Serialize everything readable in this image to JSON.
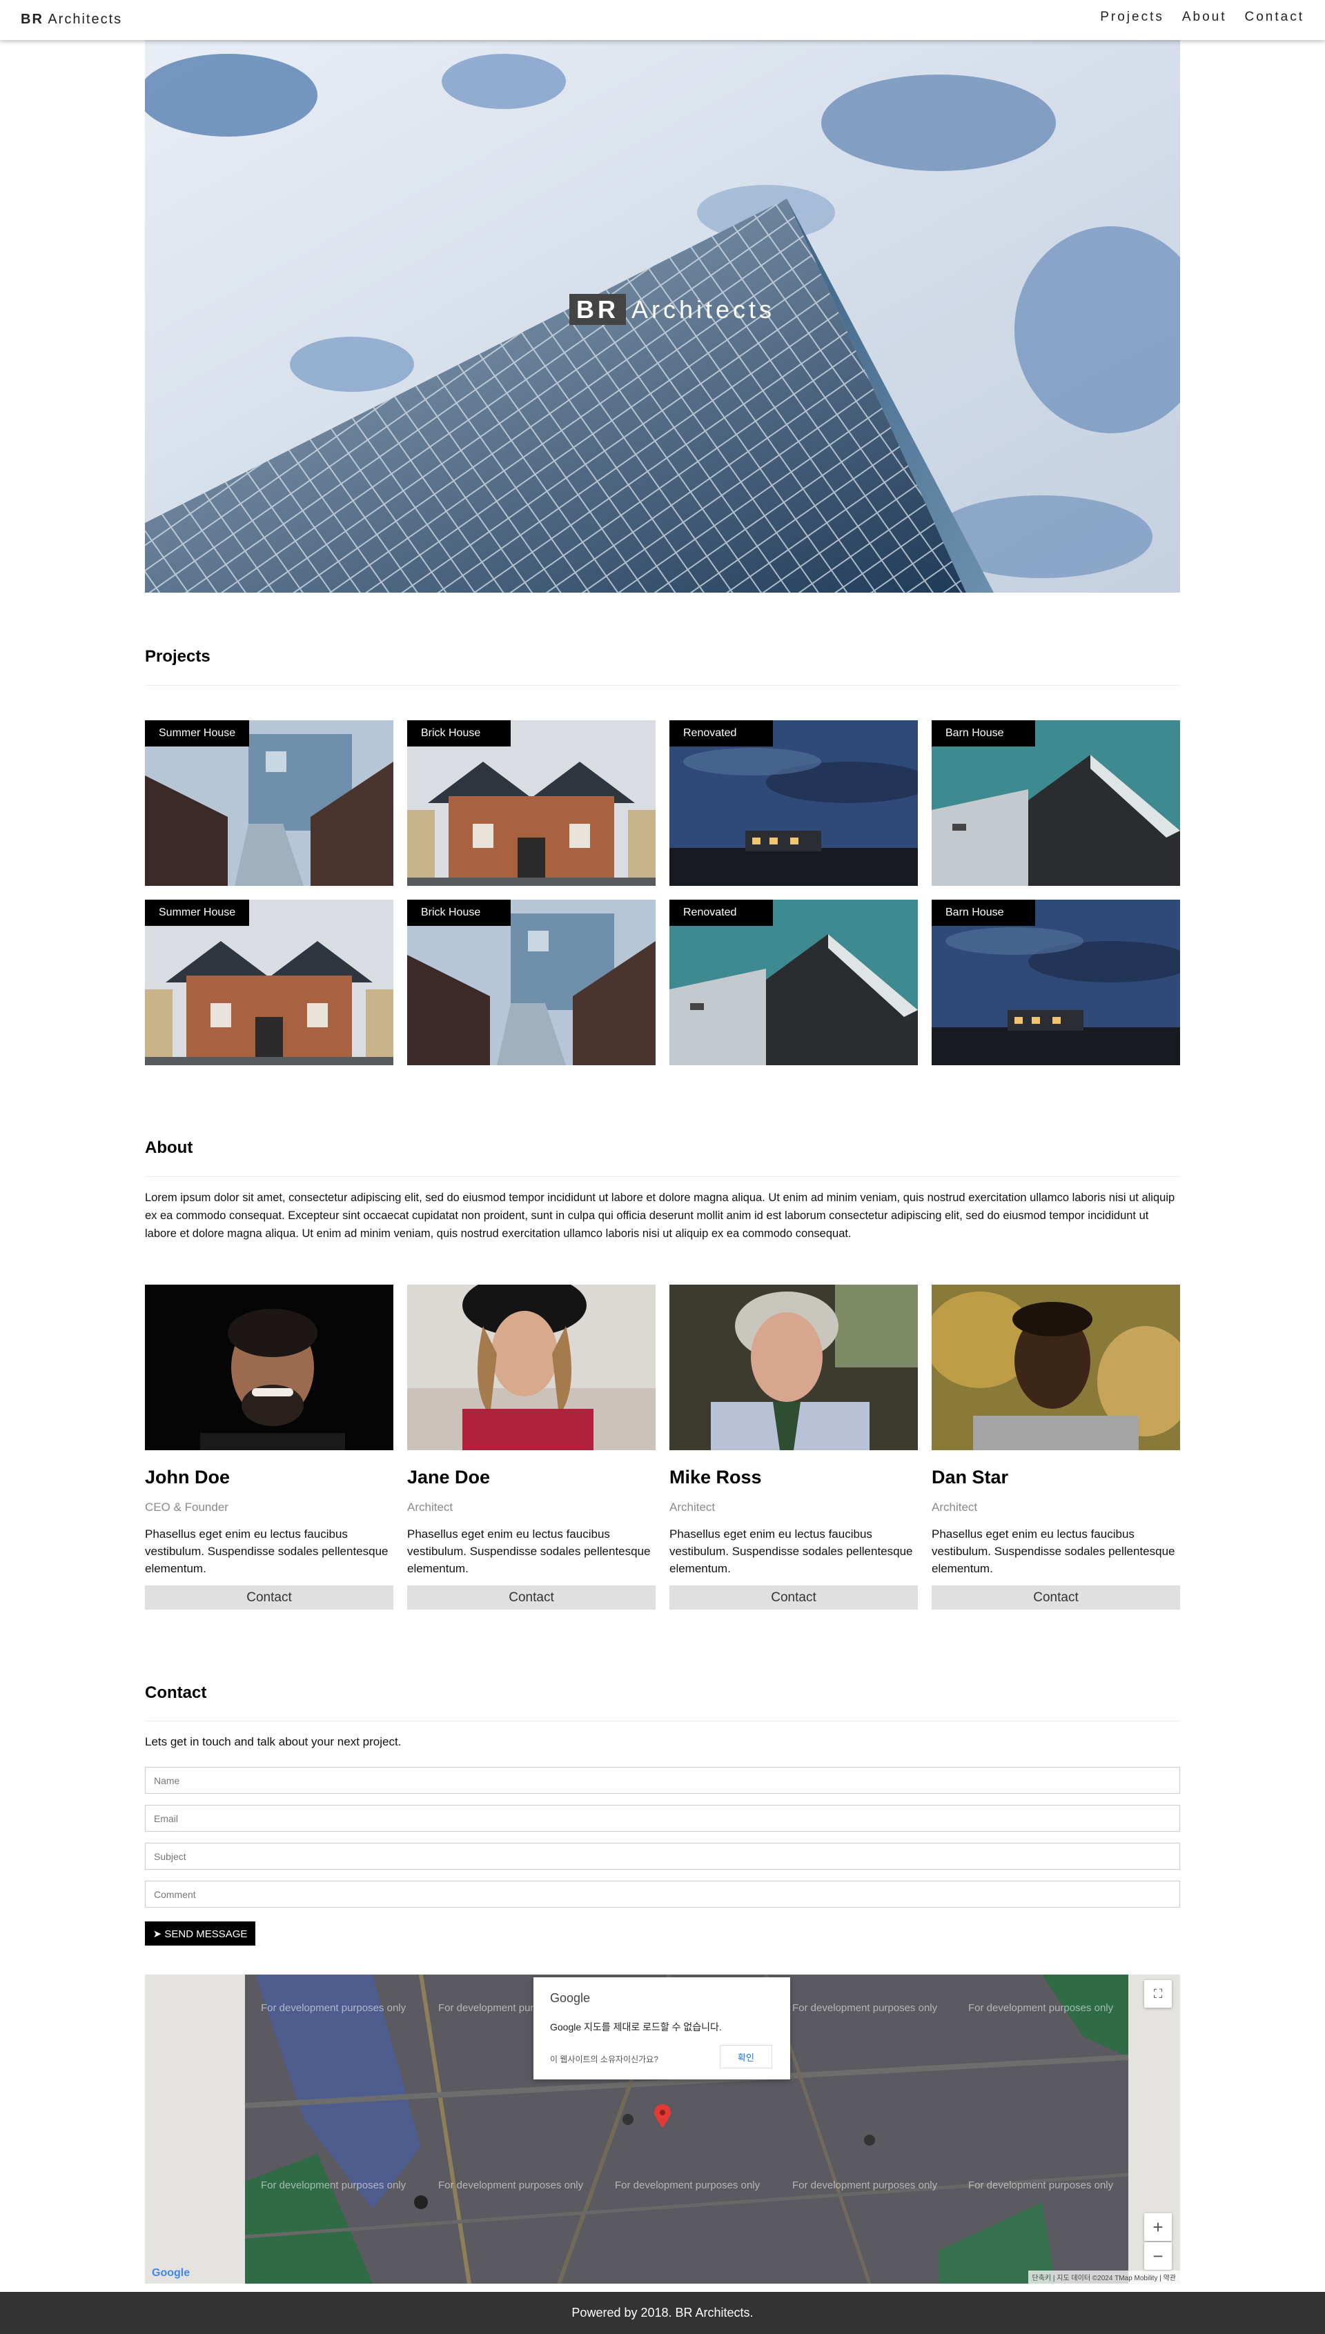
{
  "nav": {
    "brand_bold": "BR",
    "brand_rest": "Architects",
    "links": [
      "Projects",
      "About",
      "Contact"
    ]
  },
  "hero": {
    "title_bold": "BR",
    "title_rest": "Architects"
  },
  "projects": {
    "heading": "Projects",
    "items": [
      {
        "tag": "Summer House"
      },
      {
        "tag": "Brick House"
      },
      {
        "tag": "Renovated"
      },
      {
        "tag": "Barn House"
      },
      {
        "tag": "Summer House"
      },
      {
        "tag": "Brick House"
      },
      {
        "tag": "Renovated"
      },
      {
        "tag": "Barn House"
      }
    ]
  },
  "about": {
    "heading": "About",
    "text": "Lorem ipsum dolor sit amet, consectetur adipiscing elit, sed do eiusmod tempor incididunt ut labore et dolore magna aliqua. Ut enim ad minim veniam, quis nostrud exercitation ullamco laboris nisi ut aliquip ex ea commodo consequat. Excepteur sint occaecat cupidatat non proident, sunt in culpa qui officia deserunt mollit anim id est laborum consectetur adipiscing elit, sed do eiusmod tempor incididunt ut labore et dolore magna aliqua. Ut enim ad minim veniam, quis nostrud exercitation ullamco laboris nisi ut aliquip ex ea commodo consequat.",
    "team": [
      {
        "name": "John Doe",
        "role": "CEO & Founder",
        "bio": "Phasellus eget enim eu lectus faucibus vestibulum. Suspendisse sodales pellentesque elementum.",
        "button": "Contact"
      },
      {
        "name": "Jane Doe",
        "role": "Architect",
        "bio": "Phasellus eget enim eu lectus faucibus vestibulum. Suspendisse sodales pellentesque elementum.",
        "button": "Contact"
      },
      {
        "name": "Mike Ross",
        "role": "Architect",
        "bio": "Phasellus eget enim eu lectus faucibus vestibulum. Suspendisse sodales pellentesque elementum.",
        "button": "Contact"
      },
      {
        "name": "Dan Star",
        "role": "Architect",
        "bio": "Phasellus eget enim eu lectus faucibus vestibulum. Suspendisse sodales pellentesque elementum.",
        "button": "Contact"
      }
    ]
  },
  "contact": {
    "heading": "Contact",
    "lead": "Lets get in touch and talk about your next project.",
    "fields": {
      "name": "Name",
      "email": "Email",
      "subject": "Subject",
      "comment": "Comment"
    },
    "send_label": "SEND MESSAGE"
  },
  "map": {
    "dialog_brand": "Google",
    "dialog_message": "Google 지도를 제대로 로드할 수 없습니다.",
    "dialog_question": "이 웹사이트의 소유자이신가요?",
    "dialog_ok": "확인",
    "watermark": "For development purposes only",
    "logo": "Google",
    "attribution": "단축키 | 지도 데이터 ©2024 TMap Mobility | 약관"
  },
  "footer": {
    "text": "Powered by 2018. BR Architects."
  },
  "colors": {
    "footer_bg": "#333333",
    "tag_bg": "#000000",
    "contact_btn_bg": "#e0e0e0"
  }
}
